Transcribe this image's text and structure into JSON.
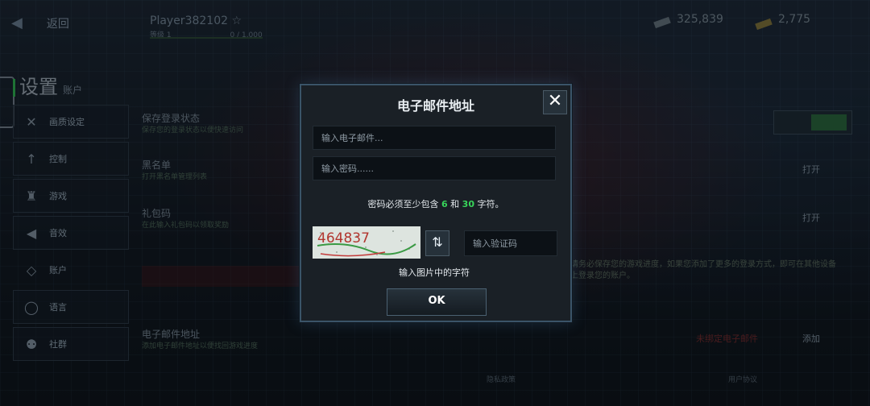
{
  "topbar": {
    "back_label": "返回",
    "player_name": "Player382102",
    "player_rank": "等级 1",
    "player_xp": "0 / 1,000",
    "currency1": {
      "value": "325,839",
      "label": "—"
    },
    "currency2": {
      "value": "2,775",
      "label": "—"
    }
  },
  "sidebar": {
    "title": "设置",
    "subtitle": "账户",
    "items": [
      {
        "label": "画质设定",
        "icon": "wrench-icon"
      },
      {
        "label": "控制",
        "icon": "arrow-up-icon"
      },
      {
        "label": "游戏",
        "icon": "chess-icon"
      },
      {
        "label": "音效",
        "icon": "megaphone-icon"
      },
      {
        "label": "账户",
        "icon": "diamond-icon"
      },
      {
        "label": "语言",
        "icon": "globe-icon"
      },
      {
        "label": "社群",
        "icon": "people-icon"
      }
    ]
  },
  "background": {
    "row1_label": "保存登录状态",
    "row1_sub": "保存您的登录状态以便快速访问",
    "row2_label": "黑名单",
    "row2_sub": "打开黑名单管理列表",
    "row2_value": "打开",
    "row3_label": "礼包码",
    "row3_sub": "在此输入礼包码以领取奖励",
    "row3_value": "打开",
    "row4_label": "电子邮件地址",
    "row4_sub": "添加电子邮件地址以便找回游戏进度",
    "row4_value": "添加",
    "red_text": "未绑定电子邮件",
    "green_note": "请务必保存您的游戏进度，如果您添加了更多的登录方式，即可在其他设备上登录您的账户。",
    "bottom_left": "隐私政策",
    "bottom_right": "用户协议"
  },
  "modal": {
    "title": "电子邮件地址",
    "close_label": "✕",
    "email_placeholder": "输入电子邮件...",
    "password_placeholder": "输入密码......",
    "pw_note_prefix": "密码必须至少包含 ",
    "pw_min": "6",
    "pw_and": " 和 ",
    "pw_max": "30",
    "pw_note_suffix": " 字符。",
    "captcha_text": "464837",
    "refresh_label": "⇅",
    "code_placeholder": "输入验证码",
    "captcha_hint": "输入图片中的字符",
    "ok_label": "OK"
  },
  "colors": {
    "accent_green": "#38d45a",
    "modal_border": "#3a5468"
  }
}
